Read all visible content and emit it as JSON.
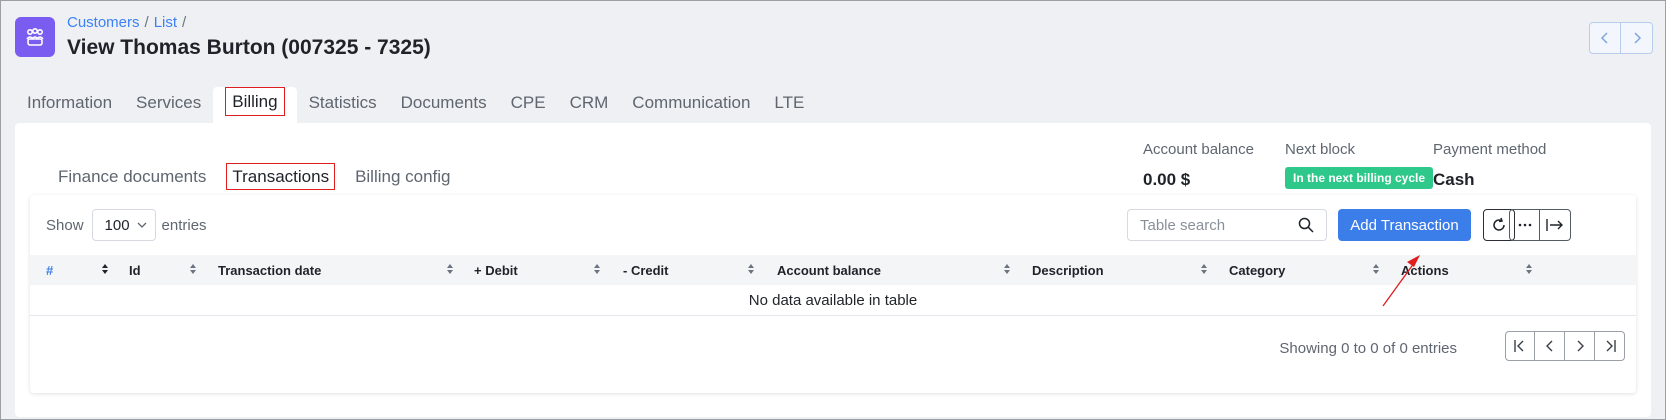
{
  "header": {
    "breadcrumb": [
      "Customers",
      "List"
    ],
    "breadcrumb_sep": "/",
    "title": "View Thomas Burton (007325 - 7325)"
  },
  "main_tabs": [
    "Information",
    "Services",
    "Billing",
    "Statistics",
    "Documents",
    "CPE",
    "CRM",
    "Communication",
    "LTE"
  ],
  "main_tab_active": "Billing",
  "sub_tabs": [
    "Finance documents",
    "Transactions",
    "Billing config"
  ],
  "sub_tab_active": "Transactions",
  "summary": {
    "account_balance_label": "Account balance",
    "account_balance_value": "0.00 $",
    "next_block_label": "Next block",
    "next_block_value": "In the next billing cycle",
    "payment_method_label": "Payment method",
    "payment_method_value": "Cash"
  },
  "table": {
    "show_label": "Show",
    "entries_label": "entries",
    "page_size": "100",
    "search_placeholder": "Table search",
    "add_button": "Add Transaction",
    "columns": [
      "#",
      "Id",
      "Transaction date",
      "+ Debit",
      "- Credit",
      "Account balance",
      "Description",
      "Category",
      "Actions"
    ],
    "empty_message": "No data available in table",
    "info": "Showing 0 to 0 of 0 entries"
  },
  "colors": {
    "brand_icon": "#7b5cf0",
    "primary_button": "#3b7de9",
    "badge": "#2ec98a",
    "annotation": "#e01e1e"
  }
}
